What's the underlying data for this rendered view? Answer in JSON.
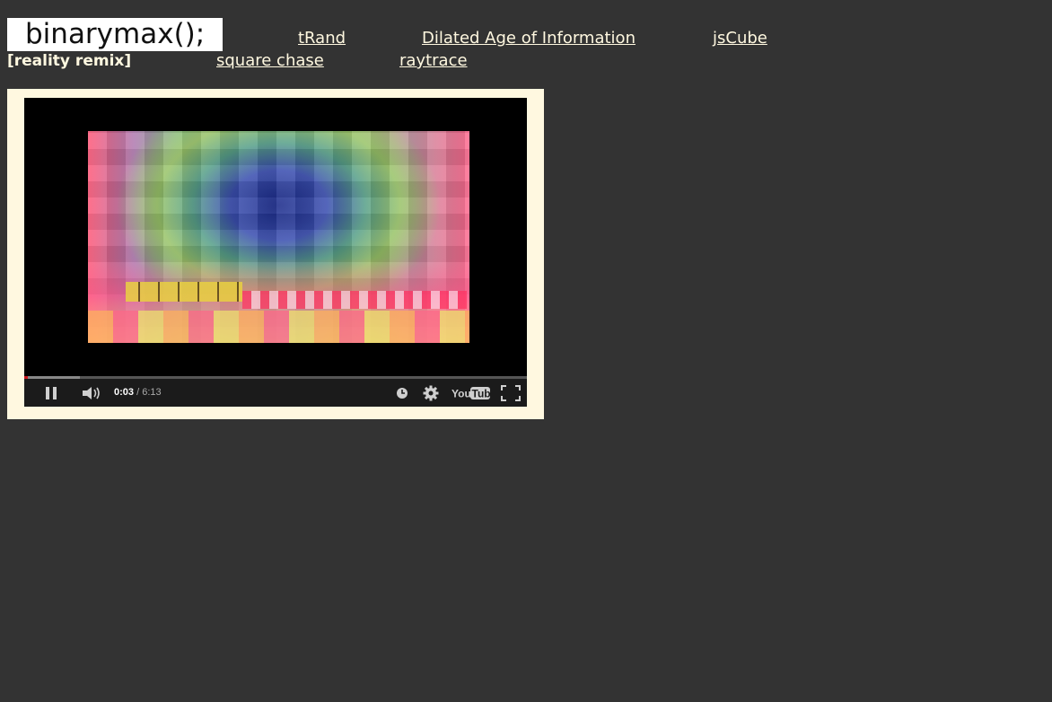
{
  "site": {
    "logo": "binarymax();"
  },
  "nav": {
    "row1": [
      {
        "label": "tRand"
      },
      {
        "label": "Dilated Age of Information"
      },
      {
        "label": "jsCube"
      }
    ],
    "current": "[reality remix]",
    "row2": [
      {
        "label": "square chase"
      },
      {
        "label": "raytrace"
      }
    ]
  },
  "player": {
    "current_time": "0:03",
    "separator": " / ",
    "duration": "6:13",
    "progress_fraction": 0.008,
    "buffered_fraction": 0.11,
    "brand": "YouTube",
    "icons": [
      "pause-icon",
      "volume-icon",
      "watch-later-icon",
      "settings-icon",
      "youtube-logo-icon",
      "fullscreen-icon"
    ]
  },
  "colors": {
    "page_bg": "#333333",
    "link": "#fff8e0",
    "frame_bg": "#fff8e0",
    "progress": "#cc181e"
  }
}
